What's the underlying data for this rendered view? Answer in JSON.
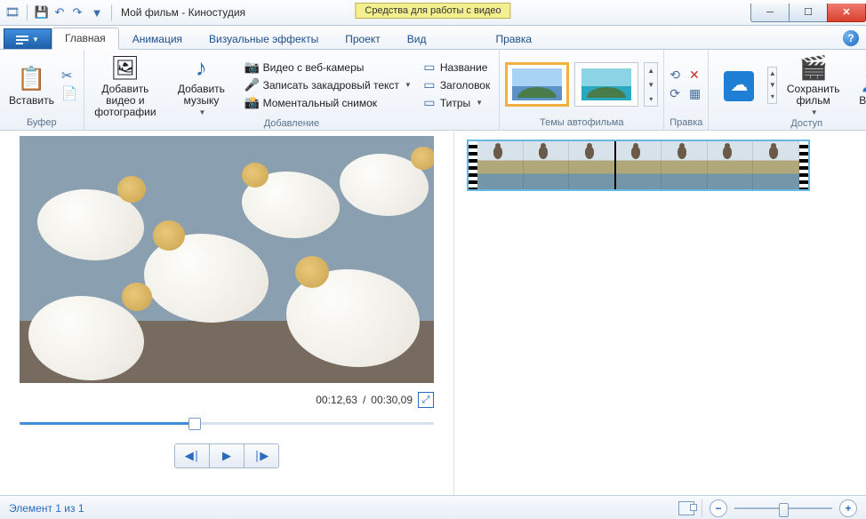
{
  "titlebar": {
    "title": "Мой фильм - Киностудия",
    "context_tab": "Средства для работы с видео"
  },
  "tabs": {
    "main": "Главная",
    "anim": "Анимация",
    "vfx": "Визуальные эффекты",
    "project": "Проект",
    "view": "Вид",
    "edit": "Правка"
  },
  "ribbon": {
    "buffer": {
      "label": "Буфер",
      "paste": "Вставить"
    },
    "add": {
      "label": "Добавление",
      "add_media": "Добавить видео и фотографии",
      "add_music": "Добавить музыку",
      "webcam": "Видео с веб-камеры",
      "voiceover": "Записать закадровый текст",
      "snapshot": "Моментальный снимок",
      "title": "Название",
      "caption": "Заголовок",
      "credits": "Титры"
    },
    "themes": {
      "label": "Темы автофильма"
    },
    "edit": {
      "label": "Правка"
    },
    "access": {
      "label": "Доступ",
      "save": "Сохранить фильм",
      "signin": "Войти"
    }
  },
  "player": {
    "time_current": "00:12,63",
    "time_total": "00:30,09"
  },
  "status": {
    "item": "Элемент 1 из 1"
  }
}
